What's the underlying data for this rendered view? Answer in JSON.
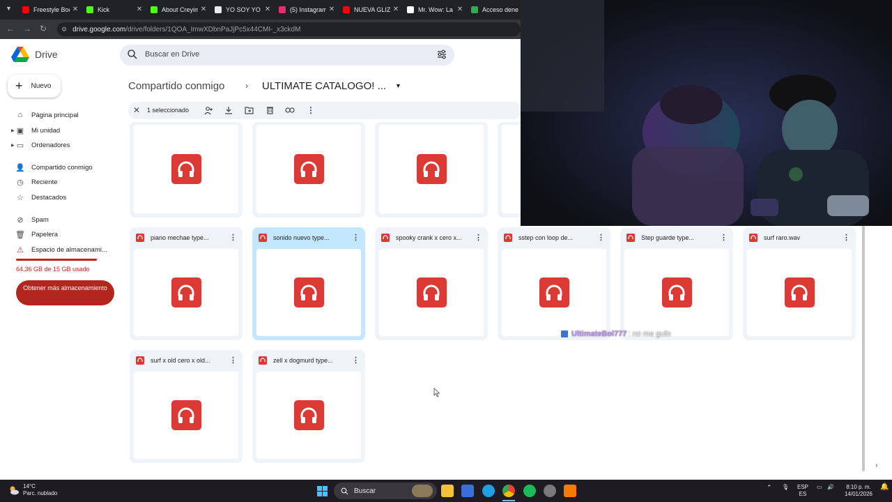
{
  "browser": {
    "tabs": [
      {
        "label": "Freestyle Boom",
        "color": "#ff0000"
      },
      {
        "label": "Kick",
        "color": "#53fc18"
      },
      {
        "label": "About Creyim",
        "color": "#53fc18"
      },
      {
        "label": "YO SOY YO",
        "color": "#e8eaed"
      },
      {
        "label": "(5) Instagram",
        "color": "#e1306c"
      },
      {
        "label": "NUEVA GLIZZ",
        "color": "#ff0000"
      },
      {
        "label": "Mr. Wow: La",
        "color": "#ffffff"
      },
      {
        "label": "Acceso dene",
        "color": "#34a853"
      }
    ],
    "url_host": "drive.google.com",
    "url_path": "/drive/folders/1QOA_ImwXDbnPaJjPc5x44CMI-_x3ckdM"
  },
  "drive": {
    "logo_text": "Drive",
    "search_placeholder": "Buscar en Drive",
    "new_label": "Nuevo",
    "nav": [
      {
        "label": "Página principal",
        "icon": "home-icon"
      },
      {
        "label": "Mi unidad",
        "icon": "drive-icon"
      },
      {
        "label": "Ordenadores",
        "icon": "computer-icon"
      },
      {
        "label": "Compartido conmigo",
        "icon": "people-icon"
      },
      {
        "label": "Reciente",
        "icon": "clock-icon"
      },
      {
        "label": "Destacados",
        "icon": "star-icon"
      },
      {
        "label": "Spam",
        "icon": "spam-icon"
      },
      {
        "label": "Papelera",
        "icon": "trash-icon"
      },
      {
        "label": "Espacio de almacenami...",
        "icon": "warning-icon"
      }
    ],
    "storage_text": "64,36 GB de 15 GB usado",
    "storage_button": "Obtener más almacenamiento",
    "breadcrumb_root": "Compartido conmigo",
    "breadcrumb_folder": "ULTIMATE CATALOGO! ...",
    "selection_text": "1 seleccionado",
    "files_row2": [
      {
        "name": "piano mechae type...",
        "selected": false
      },
      {
        "name": "sonido nuevo type...",
        "selected": true
      },
      {
        "name": "spooky crank x cero x...",
        "selected": false
      },
      {
        "name": "sstep con loop de...",
        "selected": false
      },
      {
        "name": "Step guarde type...",
        "selected": false
      },
      {
        "name": "surf raro.wav",
        "selected": false
      }
    ],
    "files_row3": [
      {
        "name": "surf x old cero x old...",
        "selected": false
      },
      {
        "name": "zell x dogmurd type...",
        "selected": false
      }
    ]
  },
  "chat": {
    "user": "UltimateBol777",
    "message": ": no me gufo"
  },
  "taskbar": {
    "temperature": "14°C",
    "weather": "Parc. nublado",
    "search_label": "Buscar",
    "lang_top": "ESP",
    "lang_bottom": "ES",
    "time": "8:10 p. m.",
    "date": "14/01/2026"
  }
}
